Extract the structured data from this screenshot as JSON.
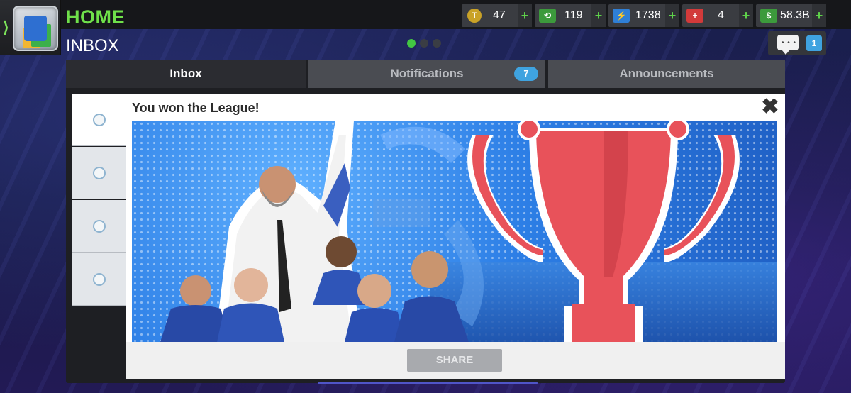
{
  "header": {
    "home_title": "HOME",
    "section_title": "INBOX",
    "home_chevron": "⟩"
  },
  "currencies": [
    {
      "icon": "token-icon",
      "glyph": "T",
      "value": "47",
      "color": "#c9a227"
    },
    {
      "icon": "training-icon",
      "glyph": "⟲",
      "value": "119",
      "color": "#3c9a3c"
    },
    {
      "icon": "energy-icon",
      "glyph": "⚡",
      "value": "1738",
      "color": "#2f7fd6"
    },
    {
      "icon": "medical-icon",
      "glyph": "+",
      "value": "4",
      "color": "#d23a3a"
    },
    {
      "icon": "cash-icon",
      "glyph": "$",
      "value": "58.3B",
      "color": "#3c9a3c"
    }
  ],
  "plus_label": "+",
  "chat": {
    "count": "1"
  },
  "tabs": [
    {
      "label": "Inbox",
      "active": true
    },
    {
      "label": "Notifications",
      "badge": "7"
    },
    {
      "label": "Announcements"
    }
  ],
  "message": {
    "title": "You won the League!",
    "close": "✖",
    "share_label": "SHARE"
  },
  "colors": {
    "home_green": "#6fe04a",
    "badge_blue": "#3fa3e0",
    "trophy_red": "#e8525a"
  }
}
